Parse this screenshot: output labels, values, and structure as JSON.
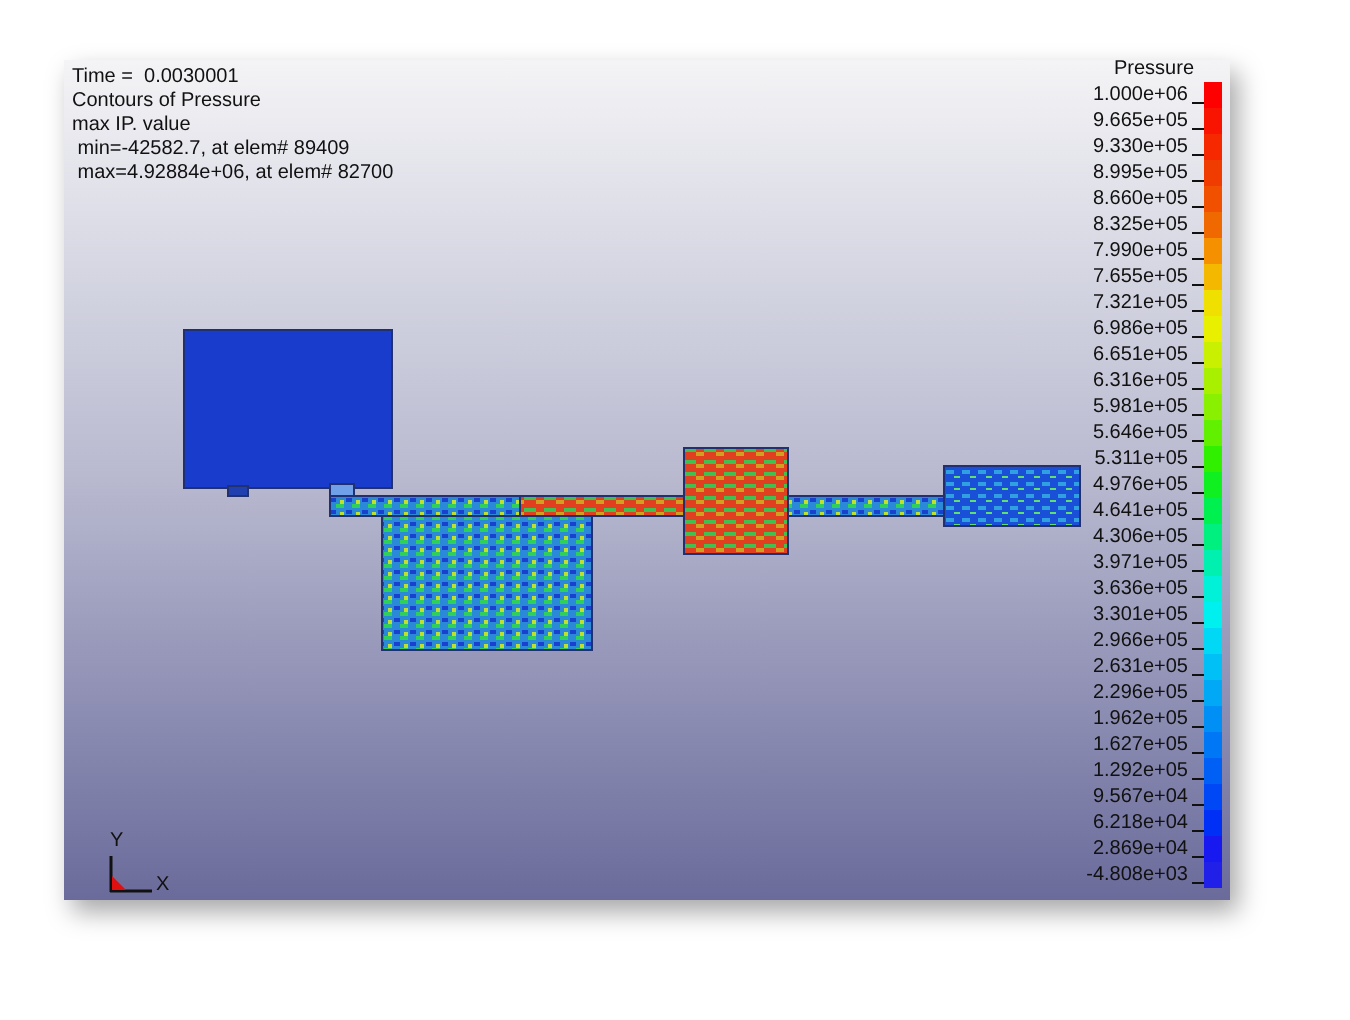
{
  "info": [
    "Time =  0.0030001",
    "Contours of Pressure",
    "max IP. value",
    " min=-42582.7, at elem# 89409",
    " max=4.92884e+06, at elem# 82700"
  ],
  "legend": {
    "title": "Pressure",
    "entries": [
      {
        "label": "1.000e+06",
        "color": "#ff0000"
      },
      {
        "label": "9.665e+05",
        "color": "#f81400"
      },
      {
        "label": "9.330e+05",
        "color": "#f52800"
      },
      {
        "label": "8.995e+05",
        "color": "#f03c00"
      },
      {
        "label": "8.660e+05",
        "color": "#f05000"
      },
      {
        "label": "8.325e+05",
        "color": "#f06800"
      },
      {
        "label": "7.990e+05",
        "color": "#f59000"
      },
      {
        "label": "7.655e+05",
        "color": "#f5b800"
      },
      {
        "label": "7.321e+05",
        "color": "#f0e000"
      },
      {
        "label": "6.986e+05",
        "color": "#e8f000"
      },
      {
        "label": "6.651e+05",
        "color": "#c8f000"
      },
      {
        "label": "6.316e+05",
        "color": "#a8f000"
      },
      {
        "label": "5.981e+05",
        "color": "#88f000"
      },
      {
        "label": "5.646e+05",
        "color": "#60f000"
      },
      {
        "label": "5.311e+05",
        "color": "#30f000"
      },
      {
        "label": "4.976e+05",
        "color": "#10f020"
      },
      {
        "label": "4.641e+05",
        "color": "#00f050"
      },
      {
        "label": "4.306e+05",
        "color": "#00f080"
      },
      {
        "label": "3.971e+05",
        "color": "#00f0b0"
      },
      {
        "label": "3.636e+05",
        "color": "#00f0d8"
      },
      {
        "label": "3.301e+05",
        "color": "#00f0f0"
      },
      {
        "label": "2.966e+05",
        "color": "#00d8f5"
      },
      {
        "label": "2.631e+05",
        "color": "#00c0f5"
      },
      {
        "label": "2.296e+05",
        "color": "#00a8f5"
      },
      {
        "label": "1.962e+05",
        "color": "#0090f5"
      },
      {
        "label": "1.627e+05",
        "color": "#0078f5"
      },
      {
        "label": "1.292e+05",
        "color": "#0060f5"
      },
      {
        "label": "9.567e+04",
        "color": "#0048f5"
      },
      {
        "label": "6.218e+04",
        "color": "#0030f5"
      },
      {
        "label": "2.869e+04",
        "color": "#1818f0"
      },
      {
        "label": "-4.808e+03",
        "color": "#2020e8"
      }
    ]
  },
  "axes": {
    "y_label": "Y",
    "x_label": "X"
  }
}
